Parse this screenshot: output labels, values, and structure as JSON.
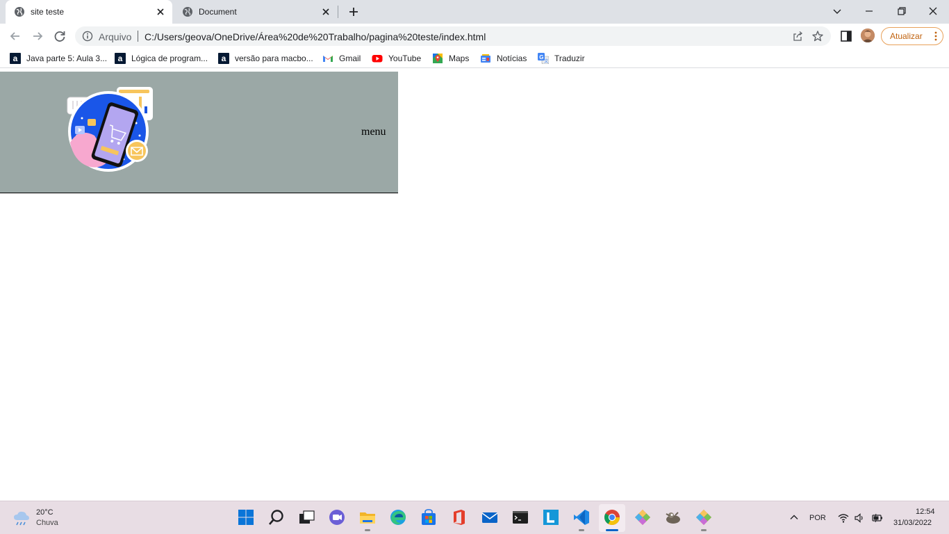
{
  "browser": {
    "tabs": [
      {
        "title": "site teste",
        "active": true
      },
      {
        "title": "Document",
        "active": false
      }
    ],
    "address_bar": {
      "scheme_label": "Arquivo",
      "url": "C:/Users/geova/OneDrive/Área%20de%20Trabalho/pagina%20teste/index.html"
    },
    "update_button": "Atualizar",
    "bookmarks": [
      {
        "label": "Java parte 5: Aula 3...",
        "icon": "alura-icon"
      },
      {
        "label": "Lógica de program...",
        "icon": "alura-icon"
      },
      {
        "label": "versão para macbo...",
        "icon": "alura-icon"
      },
      {
        "label": "Gmail",
        "icon": "gmail-icon"
      },
      {
        "label": "YouTube",
        "icon": "youtube-icon"
      },
      {
        "label": "Maps",
        "icon": "maps-icon"
      },
      {
        "label": "Notícias",
        "icon": "news-icon"
      },
      {
        "label": "Traduzir",
        "icon": "translate-icon"
      }
    ],
    "colors": {
      "tabstrip": "#dee1e6",
      "update_accent": "#e8a15a"
    }
  },
  "page": {
    "header_bg": "#9ba8a6",
    "menu_text": "menu",
    "hero_image": "mobile-shopping-illustration"
  },
  "taskbar": {
    "weather": {
      "temp": "20°C",
      "condition": "Chuva"
    },
    "language": "POR",
    "clock": {
      "time": "12:54",
      "date": "31/03/2022"
    },
    "apps": [
      "windows-start-icon",
      "search-icon",
      "task-view-icon",
      "teams-chat-icon",
      "file-explorer-icon",
      "edge-icon",
      "store-icon",
      "office-icon",
      "mail-icon",
      "terminal-icon",
      "l-app-icon",
      "vscode-icon",
      "chrome-icon",
      "git-icon",
      "gimp-icon",
      "git-icon"
    ]
  }
}
